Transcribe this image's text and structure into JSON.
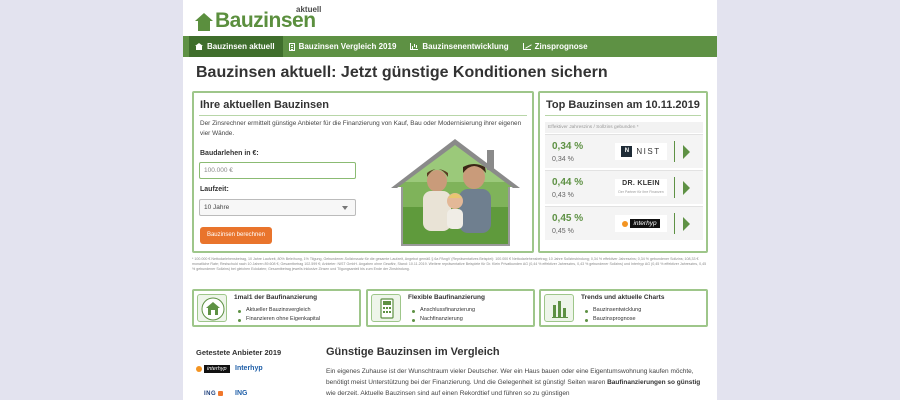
{
  "brand": {
    "name": "Bauzinsen",
    "suffix": "aktuell",
    "logo_icon": "house-icon",
    "color": "#5b8f3e"
  },
  "nav": {
    "items": [
      {
        "label": "Bauzinsen aktuell",
        "icon": "home-icon",
        "active": true
      },
      {
        "label": "Bauzinsen Vergleich 2019",
        "icon": "calculator-icon",
        "active": false
      },
      {
        "label": "Bauzinsenentwicklung",
        "icon": "bar-chart-icon",
        "active": false
      },
      {
        "label": "Zinsprognose",
        "icon": "line-chart-icon",
        "active": false
      }
    ],
    "bg_color": "#5e9144",
    "active_color": "#3f6e2c"
  },
  "page_title": "Bauzinsen aktuell: Jetzt günstige Konditionen sichern",
  "calculator": {
    "title": "Ihre aktuellen Bauzinsen",
    "intro": "Der Zinsrechner ermittelt günstige Anbieter für die Finanzierung von Kauf, Bau oder Modernisierung ihrer eigenen vier Wände.",
    "loan_label": "Baudarlehen in €:",
    "loan_placeholder": "100.000 €",
    "term_label": "Laufzeit:",
    "term_value": "10 Jahre",
    "submit_label": "Bauzinsen berechnen",
    "accent": "#e9742c"
  },
  "top_rates": {
    "title": "Top Bauzinsen am 10.11.2019",
    "header": "Effektiver Jahreszins / Sollzins gebunden *",
    "rows": [
      {
        "effective": "0,34 %",
        "nominal": "0,34 %",
        "bank": "NIST",
        "bank_mark": "N"
      },
      {
        "effective": "0,44 %",
        "nominal": "0,43 %",
        "bank": "DR. KLEIN",
        "bank_sub": "Der Partner für ihre Finanzen"
      },
      {
        "effective": "0,45 %",
        "nominal": "0,45 %",
        "bank": "interhyp"
      }
    ]
  },
  "footnote": "* 100.000 € Nettodarlehensbetrag, 10 Jahre Laufzeit, 80% Beleihung, 1% Tilgung, Gebundener-Sollzinssatz für die gesamte Laufzeit, Angebot gemäß § 6a PAngV (Repräsentatives Beispiel): 100.000 € Nettodarlehensbetrag; 10 Jahre Sollzinsbindung; 0,34 % effektiver Jahreszins; 0,34 % gebundener Sollzins; 108,33 € monatliche Rate; Restschuld nach 10 Jahren 89.608 €; Gesamtbetrag 102.599 €; Anbieter: NIST GmbH. Angaben ohne Gewähr, Stand: 10.11.2019. Weitere repräsentative Beispiele für Dr. Klein Privatkunden AG (0,44 % effektiver Jahreszins, 0,43 % gebundener Sollzins) und Interhyp AG (0,45 % effektiver Jahreszins, 0,45 % gebundener Sollzins) bei gleichen Eckdaten; Gesamtbetrag jeweils inklusive Zinsen und Tilgungsanteil bis zum Ende der Zinsbindung.",
  "features": [
    {
      "title": "1mal1 der Baufinanzierung",
      "icon": "house-outline-icon",
      "items": [
        "Aktueller Bauzinsvergleich",
        "Finanzieren ohne Eigenkapital"
      ]
    },
    {
      "title": "Flexible Baufinanzierung",
      "icon": "calculator-icon",
      "items": [
        "Anschlussfinanzierung",
        "Nachfinanzierung"
      ]
    },
    {
      "title": "Trends und aktuelle Charts",
      "icon": "bar-chart-icon",
      "items": [
        "Bauzinsentwicklung",
        "Bauzinsprognose"
      ]
    }
  ],
  "sidebar": {
    "title": "Getestete Anbieter 2019",
    "providers": [
      {
        "name": "Interhyp",
        "logo": "interhyp"
      },
      {
        "name": "ING",
        "logo": "ING"
      }
    ]
  },
  "section": {
    "title": "Günstige Bauzinsen im Vergleich",
    "text_1": "Ein eigenes Zuhause ist der Wunschtraum vieler Deutscher. Wer ein Haus bauen oder eine Eigentumswohnung kaufen möchte, benötigt meist Unterstützung bei der Finanzierung. Und die Gelegenheit ist günstig! Seiten waren ",
    "text_bold": "Baufinanzierungen so günstig",
    "text_2": " wie derzeit. Aktuelle Bauzinsen sind auf einen Rekordtief und führen so zu günstigen"
  }
}
